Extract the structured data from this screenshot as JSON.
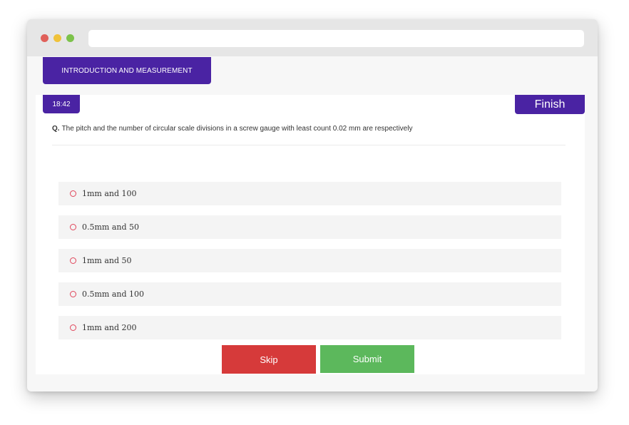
{
  "topic": {
    "title": "INTRODUCTION AND MEASUREMENT"
  },
  "quiz": {
    "timer": "18:42",
    "finish_label": "Finish",
    "question_prefix": "Q.",
    "question_text": "The pitch and the number of circular scale divisions in a screw gauge with least count 0.02 mm are respectively",
    "options": [
      {
        "label": "1mm  and  100"
      },
      {
        "label": "0.5mm  and  50"
      },
      {
        "label": "1mm  and  50"
      },
      {
        "label": "0.5mm  and  100"
      },
      {
        "label": "1mm  and  200"
      }
    ],
    "skip_label": "Skip",
    "submit_label": "Submit"
  },
  "colors": {
    "brand": "#4a23a3",
    "skip": "#d63a3a",
    "submit": "#5cb85c",
    "radio": "#e0445a"
  }
}
